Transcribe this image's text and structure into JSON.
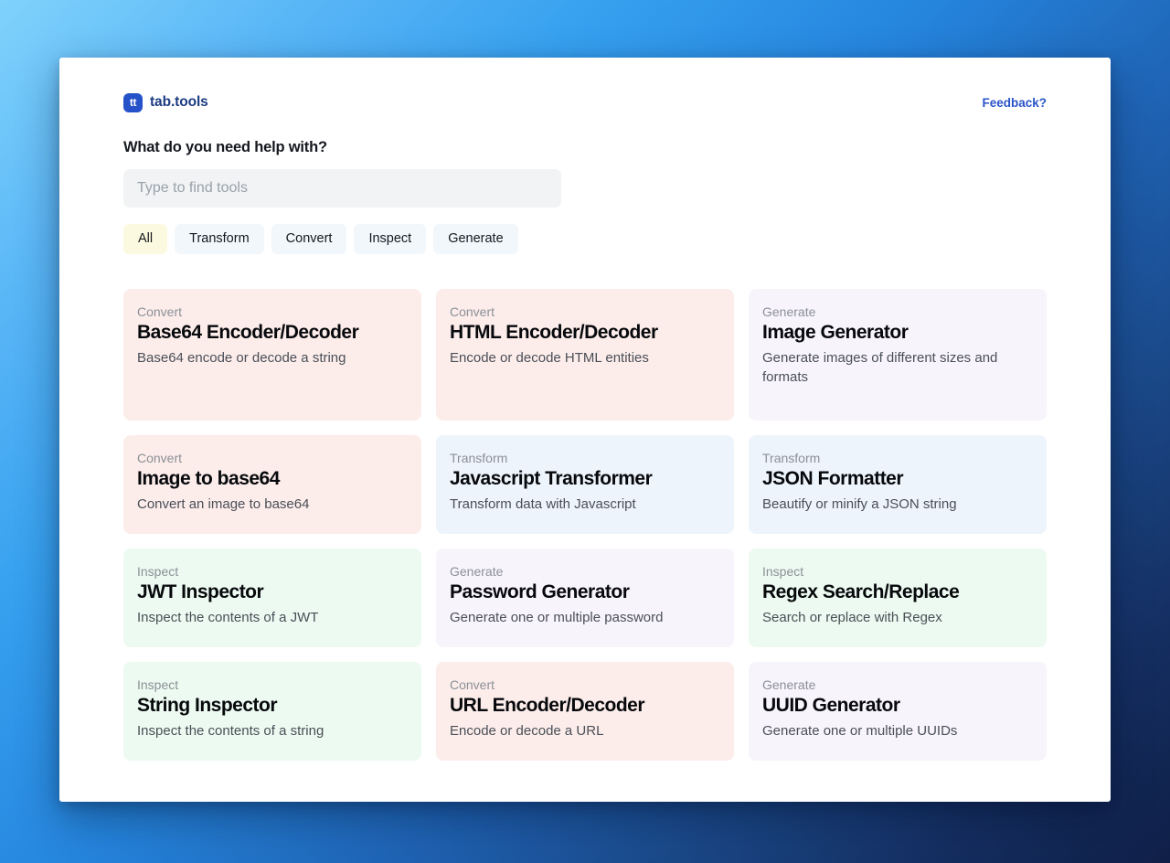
{
  "brand": {
    "mark_text": "tt",
    "name": "tab.tools",
    "mark_color": "#2552c8",
    "name_color": "#1c3b82"
  },
  "header": {
    "feedback_label": "Feedback?",
    "feedback_color": "#2a53c9"
  },
  "search": {
    "title": "What do you need help with?",
    "placeholder": "Type to find tools",
    "value": ""
  },
  "filters": {
    "active": "All",
    "active_bg": "#fbfae0",
    "inactive_bg": "#f2f7fc",
    "items": [
      {
        "label": "All"
      },
      {
        "label": "Transform"
      },
      {
        "label": "Convert"
      },
      {
        "label": "Inspect"
      },
      {
        "label": "Generate"
      }
    ]
  },
  "category_colors": {
    "Convert": "#fcedeb",
    "Generate": "#f8f4fb",
    "Transform": "#eef4fc",
    "Inspect": "#edfaf1"
  },
  "tools": [
    {
      "category": "Convert",
      "title": "Base64 Encoder/Decoder",
      "description": "Base64 encode or decode a string"
    },
    {
      "category": "Convert",
      "title": "HTML Encoder/Decoder",
      "description": "Encode or decode HTML entities"
    },
    {
      "category": "Generate",
      "title": "Image Generator",
      "description": "Generate images of different sizes and formats"
    },
    {
      "category": "Convert",
      "title": "Image to base64",
      "description": "Convert an image to base64"
    },
    {
      "category": "Transform",
      "title": "Javascript Transformer",
      "description": "Transform data with Javascript"
    },
    {
      "category": "Transform",
      "title": "JSON Formatter",
      "description": "Beautify or minify a JSON string"
    },
    {
      "category": "Inspect",
      "title": "JWT Inspector",
      "description": "Inspect the contents of a JWT"
    },
    {
      "category": "Generate",
      "title": "Password Generator",
      "description": "Generate one or multiple password"
    },
    {
      "category": "Inspect",
      "title": "Regex Search/Replace",
      "description": "Search or replace with Regex"
    },
    {
      "category": "Inspect",
      "title": "String Inspector",
      "description": "Inspect the contents of a string"
    },
    {
      "category": "Convert",
      "title": "URL Encoder/Decoder",
      "description": "Encode or decode a URL"
    },
    {
      "category": "Generate",
      "title": "UUID Generator",
      "description": "Generate one or multiple UUIDs"
    }
  ]
}
